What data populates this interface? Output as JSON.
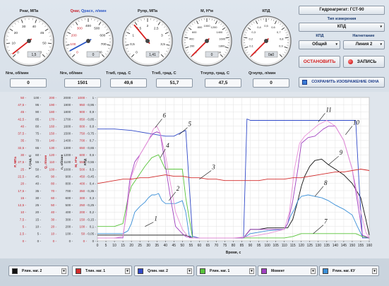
{
  "gauges": [
    {
      "title": "Pнаг, МПа",
      "title_b": "",
      "min": 0,
      "max": 60,
      "ticks": [
        "0",
        "10",
        "20",
        "30",
        "40",
        "45",
        "50",
        "60"
      ],
      "value": 1.5,
      "readout": "1,5",
      "needle": "#d81e1e"
    },
    {
      "title": "Qнаг, ",
      "title_b": "Qрасх, л/мин",
      "min": 0,
      "max": 800,
      "ticks": [
        "0",
        "100",
        "200",
        "300",
        "400",
        "500",
        "600",
        "700",
        "800"
      ],
      "value": 50,
      "readout": "0",
      "needle": "#2a56c6"
    },
    {
      "title": "Pупр, МПа",
      "title_b": "",
      "min": 0,
      "max": 4,
      "ticks": [
        "0",
        "0,5",
        "1",
        "1,5",
        "2",
        "2,5",
        "3",
        "3,5",
        "4"
      ],
      "value": 1.41,
      "readout": "1,41",
      "needle": "#d81e1e"
    },
    {
      "title": "M, Н*м",
      "title_b": "",
      "min": 0,
      "max": 2000,
      "ticks": [
        "0",
        "200",
        "400",
        "600",
        "800",
        "1000",
        "1200",
        "1400",
        "1600",
        "1800",
        "2000"
      ],
      "value": 0,
      "readout": "0",
      "needle": "#d81e1e"
    },
    {
      "title": "КПД",
      "title_b": "",
      "min": 0,
      "max": 1,
      "ticks": [
        "0",
        "0,1",
        "0,2",
        "0,3",
        "0,4",
        "0,5",
        "0,6",
        "0,7",
        "0,8",
        "0,9",
        "1"
      ],
      "value": 0,
      "readout": "0a0",
      "needle": "#d81e1e"
    }
  ],
  "unit": {
    "title": "Гидроагрегат: ГСТ-90",
    "measure_type_label": "Тип измерения",
    "measure_type": "КПД",
    "kpd_label": "КПД",
    "load_label": "Нагнетание",
    "kpd_value": "Общий",
    "load_value": "Линия 2",
    "stop": "ОСТАНОВИТЬ",
    "record": "ЗАПИСЬ",
    "save_image": "СОХРАНИТЬ ИЗОБРАЖЕНИЕ ОКНА"
  },
  "readouts": [
    {
      "label": "Nгм, об/мин",
      "value": "0"
    },
    {
      "label": "Nгн, об/мин",
      "value": "1501"
    },
    {
      "label": "Tгмб, град. С",
      "value": "49,6"
    },
    {
      "label": "Tгнб, град. С",
      "value": "51,7"
    },
    {
      "label": "Tгнупр, град. С",
      "value": "47,5"
    },
    {
      "label": "Qгнупр, л/мин",
      "value": "0"
    }
  ],
  "chart_data": {
    "type": "line",
    "xlabel": "Время, с",
    "x_ticks": [
      "0",
      "5",
      "10",
      "15",
      "20",
      "25",
      "30",
      "35",
      "40",
      "45",
      "50",
      "55",
      "60",
      "65",
      "70",
      "75",
      "80",
      "85",
      "90",
      "95",
      "100",
      "105",
      "110",
      "115",
      "120",
      "125",
      "130",
      "135",
      "140",
      "145",
      "150",
      "155",
      "160"
    ],
    "xlim": [
      0,
      160
    ],
    "ylim": [
      0,
      1
    ],
    "y_axes": [
      {
        "label": "P, МПа",
        "color": "#c8262f",
        "ticks": [
          "0",
          "2,5",
          "5",
          "7,5",
          "10",
          "12,5",
          "15",
          "17,5",
          "20",
          "22,5",
          "25",
          "27,5",
          "30",
          "32,5",
          "35",
          "37,5",
          "40",
          "42,5",
          "45",
          "47,5",
          "50"
        ]
      },
      {
        "label": "T, град. С",
        "color": "#333333",
        "ticks": [
          "0",
          "5",
          "10",
          "15",
          "20",
          "25",
          "30",
          "35",
          "40",
          "45",
          "50",
          "55",
          "60",
          "65",
          "70",
          "75",
          "80",
          "85",
          "90",
          "95",
          "100"
        ]
      },
      {
        "label": "Q, л/мин",
        "color": "#c8262f",
        "ticks": [
          "0",
          "10",
          "20",
          "30",
          "40",
          "50",
          "60",
          "70",
          "80",
          "90",
          "100",
          "110",
          "120",
          "130",
          "140",
          "150",
          "160",
          "170",
          "180",
          "190",
          "200"
        ]
      },
      {
        "label": "n, об/мин",
        "color": "#333333",
        "ticks": [
          "0",
          "100",
          "200",
          "300",
          "400",
          "500",
          "600",
          "700",
          "800",
          "900",
          "1000",
          "1100",
          "1200",
          "1300",
          "1400",
          "1500",
          "1600",
          "1700",
          "1800",
          "1900",
          "2000"
        ]
      },
      {
        "label": "M, Н*м",
        "color": "#c8262f",
        "ticks": [
          "0",
          "50",
          "100",
          "150",
          "200",
          "250",
          "300",
          "350",
          "400",
          "450",
          "500",
          "550",
          "600",
          "650",
          "700",
          "750",
          "800",
          "850",
          "900",
          "950",
          "1000"
        ]
      },
      {
        "label": "КПД",
        "color": "#333333",
        "ticks": [
          "0",
          "0,05",
          "0,1",
          "0,15",
          "0,2",
          "0,25",
          "0,3",
          "0,35",
          "0,4",
          "0,45",
          "0,5",
          "0,55",
          "0,6",
          "0,65",
          "0,7",
          "0,75",
          "0,8",
          "0,85",
          "0,9",
          "0,95",
          "1"
        ]
      }
    ],
    "series": [
      {
        "color": "#111111",
        "x": [
          0,
          5,
          10,
          15,
          20,
          25,
          30,
          35,
          40,
          45,
          50,
          52,
          54,
          56,
          60,
          70,
          80,
          86,
          88,
          90,
          95,
          100,
          105,
          110,
          112,
          115,
          118,
          120,
          122,
          125,
          128,
          132,
          136,
          140,
          145,
          150,
          155,
          158,
          160
        ],
        "y": [
          0.04,
          0.04,
          0.04,
          0.04,
          0.04,
          0.04,
          0.04,
          0.04,
          0.04,
          0.04,
          0.04,
          0.04,
          0.03,
          0.02,
          0.02,
          0.02,
          0.02,
          0.02,
          0.05,
          0.08,
          0.08,
          0.09,
          0.09,
          0.09,
          0.09,
          0.15,
          0.28,
          0.38,
          0.45,
          0.52,
          0.56,
          0.57,
          0.53,
          0.5,
          0.46,
          0.4,
          0.3,
          0.15,
          0.04
        ]
      },
      {
        "color": "#3a8fd8",
        "x": [
          0,
          5,
          10,
          15,
          18,
          20,
          22,
          25,
          28,
          30,
          32,
          34,
          36,
          38,
          40,
          42,
          44,
          46,
          48,
          50,
          52,
          54,
          56,
          60,
          80,
          86,
          90,
          100,
          110,
          112,
          114,
          116,
          118,
          120,
          124,
          128,
          132,
          136,
          140,
          145,
          150,
          153,
          156,
          160
        ],
        "y": [
          0.05,
          0.05,
          0.05,
          0.05,
          0.07,
          0.12,
          0.2,
          0.24,
          0.27,
          0.3,
          0.32,
          0.32,
          0.33,
          0.28,
          0.26,
          0.26,
          0.26,
          0.26,
          0.27,
          0.28,
          0.2,
          0.04,
          0.02,
          0.02,
          0.02,
          0.02,
          0.05,
          0.07,
          0.08,
          0.12,
          0.18,
          0.22,
          0.28,
          0.31,
          0.32,
          0.31,
          0.3,
          0.28,
          0.25,
          0.22,
          0.18,
          0.1,
          0.03,
          0.02
        ]
      },
      {
        "color": "#3049c8",
        "x": [
          0,
          10,
          20,
          30,
          35,
          40,
          45,
          50,
          52,
          54,
          56,
          60,
          80,
          86,
          88,
          90,
          95,
          100,
          110,
          120,
          130,
          140,
          150,
          152,
          154,
          156,
          160
        ],
        "y": [
          0.78,
          0.78,
          0.77,
          0.75,
          0.74,
          0.73,
          0.73,
          0.76,
          0.77,
          0.4,
          0.03,
          0.02,
          0.02,
          0.02,
          0.85,
          0.84,
          0.84,
          0.84,
          0.84,
          0.84,
          0.84,
          0.84,
          0.84,
          0.84,
          0.4,
          0.02,
          0.02
        ]
      },
      {
        "color": "#58c43a",
        "x": [
          0,
          5,
          10,
          15,
          18,
          20,
          24,
          28,
          32,
          34,
          36,
          38,
          40,
          42,
          46,
          50,
          52,
          56,
          60,
          80,
          90,
          110,
          115,
          120,
          125,
          130,
          140,
          145,
          150,
          152,
          156,
          160
        ],
        "y": [
          0.1,
          0.1,
          0.1,
          0.12,
          0.3,
          0.38,
          0.45,
          0.52,
          0.58,
          0.59,
          0.6,
          0.55,
          0.5,
          0.5,
          0.5,
          0.5,
          0.3,
          0.02,
          0.02,
          0.02,
          0.02,
          0.02,
          0.03,
          0.05,
          0.05,
          0.05,
          0.05,
          0.05,
          0.05,
          0.05,
          0.03,
          0.02
        ]
      },
      {
        "color": "#a040c0",
        "x": [
          0,
          5,
          10,
          15,
          17,
          19,
          22,
          25,
          28,
          31,
          33,
          35,
          37,
          39,
          41,
          43,
          46,
          50,
          52,
          56,
          60,
          80,
          86,
          90,
          100,
          110,
          112,
          115,
          118,
          120,
          124,
          128,
          130,
          133,
          136,
          140,
          145,
          150,
          154,
          156,
          160
        ],
        "y": [
          0.02,
          0.02,
          0.02,
          0.02,
          0.2,
          0.42,
          0.55,
          0.6,
          0.66,
          0.72,
          0.75,
          0.76,
          0.75,
          0.6,
          0.45,
          0.3,
          0.1,
          0.05,
          0.03,
          0.02,
          0.02,
          0.02,
          0.02,
          0.08,
          0.08,
          0.08,
          0.12,
          0.28,
          0.5,
          0.68,
          0.72,
          0.73,
          0.75,
          0.78,
          0.8,
          0.8,
          0.7,
          0.5,
          0.2,
          0.04,
          0.02
        ]
      },
      {
        "color": "#e890d8",
        "x": [
          0,
          10,
          15,
          17,
          20,
          25,
          30,
          33,
          35,
          37,
          40,
          43,
          46,
          50,
          54,
          56,
          60,
          80,
          90,
          100,
          110,
          113,
          116,
          119,
          122,
          126,
          130,
          135,
          140,
          145,
          150,
          155,
          158,
          160
        ],
        "y": [
          0.02,
          0.02,
          0.03,
          0.18,
          0.45,
          0.6,
          0.7,
          0.78,
          0.8,
          0.75,
          0.6,
          0.4,
          0.2,
          0.08,
          0.02,
          0.02,
          0.02,
          0.02,
          0.03,
          0.05,
          0.08,
          0.2,
          0.5,
          0.68,
          0.73,
          0.77,
          0.81,
          0.84,
          0.8,
          0.7,
          0.5,
          0.2,
          0.06,
          0.02
        ]
      },
      {
        "color": "#d22b2b",
        "x": [
          0,
          5,
          10,
          15,
          20,
          25,
          30,
          35,
          40,
          45,
          50,
          55,
          60,
          65,
          70,
          75,
          80,
          85,
          90,
          95,
          100,
          105,
          110,
          115,
          120,
          125,
          130,
          135,
          140,
          145,
          150,
          155,
          160
        ],
        "y": [
          0.4,
          0.41,
          0.42,
          0.43,
          0.43,
          0.44,
          0.44,
          0.45,
          0.46,
          0.45,
          0.45,
          0.44,
          0.44,
          0.43,
          0.43,
          0.42,
          0.42,
          0.42,
          0.42,
          0.42,
          0.43,
          0.43,
          0.43,
          0.44,
          0.44,
          0.45,
          0.46,
          0.47,
          0.48,
          0.48,
          0.49,
          0.5,
          0.49
        ]
      }
    ],
    "annotations": [
      {
        "text": "1",
        "x": 28,
        "y": 0.1,
        "tx": 33,
        "ty": 0.14
      },
      {
        "text": "2",
        "x": 42,
        "y": 0.28,
        "tx": 46,
        "ty": 0.35
      },
      {
        "text": "3",
        "x": 60,
        "y": 0.43,
        "tx": 67,
        "ty": 0.5
      },
      {
        "text": "4",
        "x": 37,
        "y": 0.58,
        "tx": 40,
        "ty": 0.65
      },
      {
        "text": "5",
        "x": 48,
        "y": 0.74,
        "tx": 53,
        "ty": 0.8
      },
      {
        "text": "6",
        "x": 34,
        "y": 0.79,
        "tx": 38,
        "ty": 0.86
      },
      {
        "text": "7",
        "x": 127,
        "y": 0.05,
        "tx": 133,
        "ty": 0.12
      },
      {
        "text": "8",
        "x": 128,
        "y": 0.31,
        "tx": 133,
        "ty": 0.39
      },
      {
        "text": "9",
        "x": 136,
        "y": 0.53,
        "tx": 142,
        "ty": 0.6
      },
      {
        "text": "10",
        "x": 146,
        "y": 0.74,
        "tx": 150,
        "ty": 0.81
      },
      {
        "text": "11",
        "x": 130,
        "y": 0.83,
        "tx": 134,
        "ty": 0.9
      }
    ]
  },
  "legend": [
    {
      "label": "Рлин. наг. 2",
      "color": "#111111"
    },
    {
      "label": "Tлин. наг. 1",
      "color": "#d22b2b"
    },
    {
      "label": "Qлин. наг. 2",
      "color": "#3049c8"
    },
    {
      "label": "Рлин. наг. 1",
      "color": "#58c43a"
    },
    {
      "label": "Момент",
      "color": "#a040c0"
    },
    {
      "label": "Рлин. наг. КУ",
      "color": "#3a8fd8"
    }
  ]
}
